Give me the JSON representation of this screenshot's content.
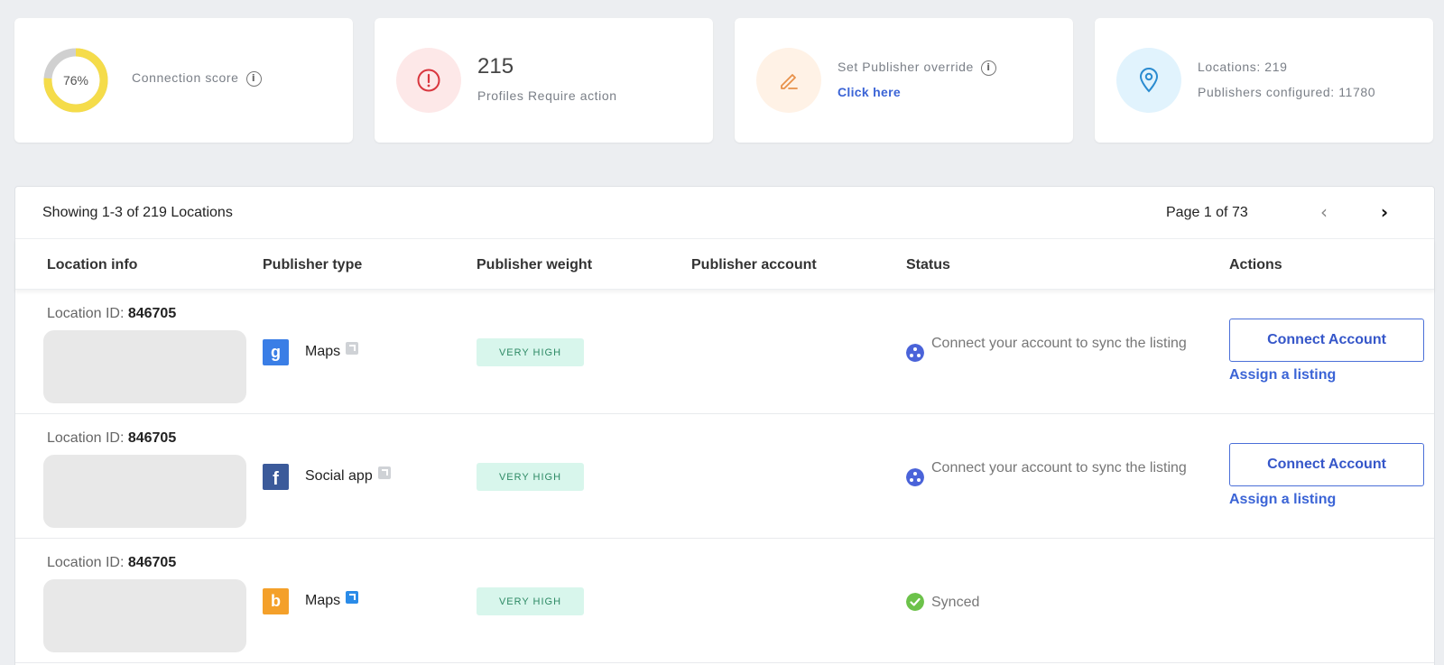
{
  "summary": {
    "connection_score": {
      "value": "76%",
      "fraction": 0.76,
      "label": "Connection score"
    },
    "profiles": {
      "count": "215",
      "label": "Profiles Require action"
    },
    "override": {
      "label": "Set Publisher override",
      "link": "Click here"
    },
    "locations": {
      "locations_text": "Locations: 219",
      "publishers_text": "Publishers configured: 11780"
    }
  },
  "table": {
    "showing": "Showing 1-3 of 219 Locations",
    "page": "Page 1 of 73",
    "headers": [
      "Location info",
      "Publisher type",
      "Publisher weight",
      "Publisher account",
      "Status",
      "Actions"
    ],
    "rows": [
      {
        "location_label": "Location ID: ",
        "location_id": "846705",
        "publisher_icon": "google-maps-icon",
        "publisher": "Maps",
        "weight": "VERY HIGH",
        "status_icon": "sync-needed-icon",
        "status": "Connect your account to sync the listing",
        "connect_label": "Connect Account",
        "assign_label": "Assign a listing"
      },
      {
        "location_label": "Location ID: ",
        "location_id": "846705",
        "publisher_icon": "facebook-icon",
        "publisher": "Social app",
        "weight": "VERY HIGH",
        "status_icon": "sync-needed-icon",
        "status": "Connect your account to sync the listing",
        "connect_label": "Connect Account",
        "assign_label": "Assign a listing"
      },
      {
        "location_label": "Location ID: ",
        "location_id": "846705",
        "publisher_icon": "bing-maps-icon",
        "publisher": "Maps",
        "weight": "VERY HIGH",
        "status_icon": "synced-check-icon",
        "status": "Synced"
      }
    ]
  },
  "colors": {
    "donut_fill": "#f5dc4a",
    "donut_track": "#d0d0d0",
    "link": "#3b64d6",
    "badge_bg": "#d8f6ec",
    "badge_text": "#2e8a65"
  }
}
